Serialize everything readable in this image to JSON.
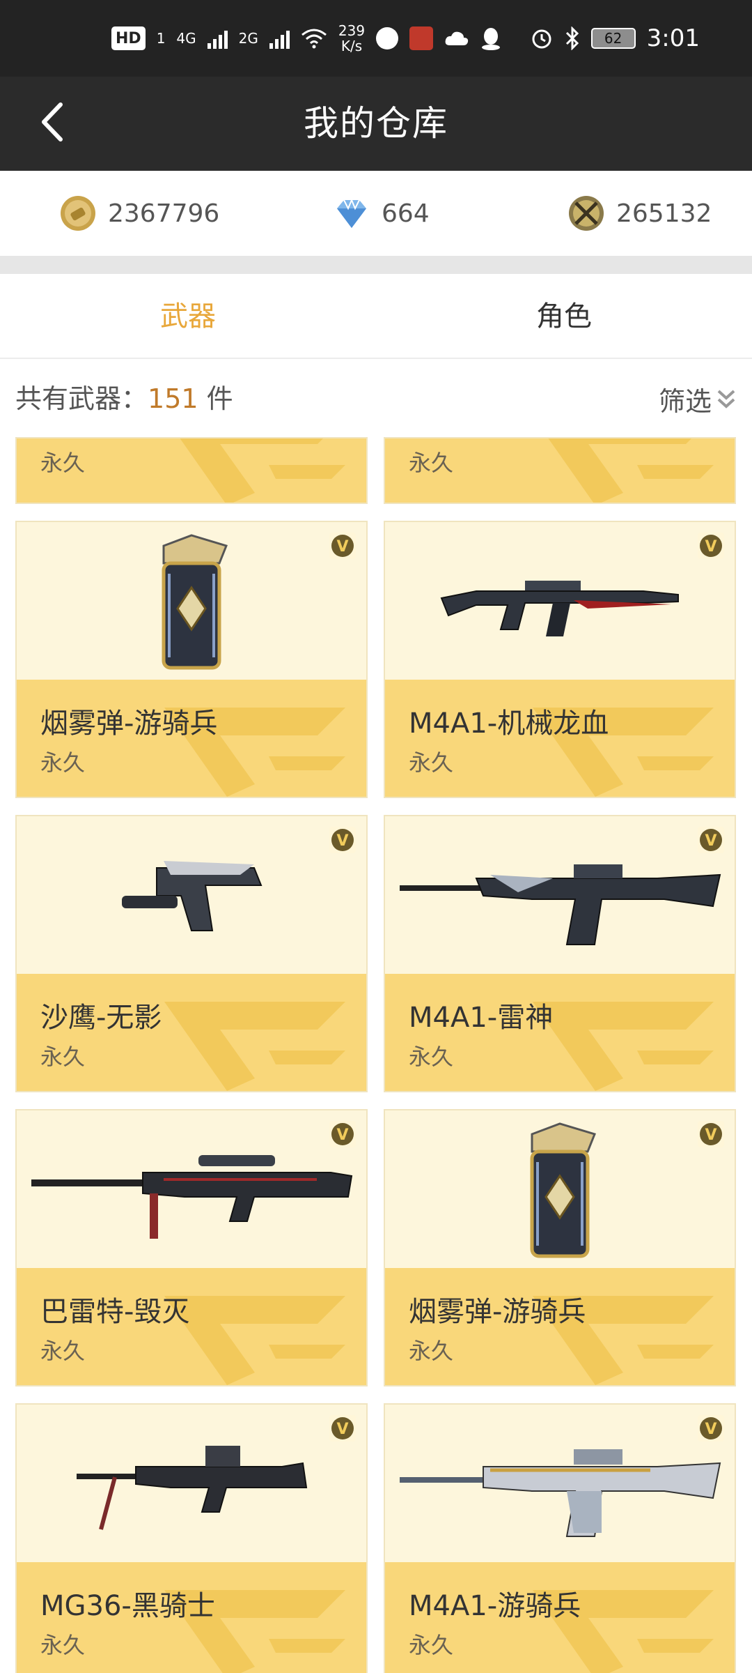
{
  "status_bar": {
    "hd_label": "HD",
    "sim1": "1",
    "net1": "4G",
    "net2": "2G",
    "speed_value": "239",
    "speed_unit": "K/s",
    "battery": "62",
    "time": "3:01"
  },
  "header": {
    "title": "我的仓库"
  },
  "currency": {
    "gold": "2367796",
    "diamond": "664",
    "medal": "265132"
  },
  "tabs": [
    {
      "label": "武器",
      "active": true
    },
    {
      "label": "角色",
      "active": false
    }
  ],
  "summary": {
    "prefix": "共有武器：",
    "count": "151",
    "suffix": "件",
    "filter_label": "筛选"
  },
  "partial_row": [
    {
      "duration": "永久"
    },
    {
      "duration": "永久"
    }
  ],
  "items": [
    {
      "name": "烟雾弹-游骑兵",
      "duration": "永久",
      "kind": "grenade"
    },
    {
      "name": "M4A1-机械龙血",
      "duration": "永久",
      "kind": "rifle"
    },
    {
      "name": "沙鹰-无影",
      "duration": "永久",
      "kind": "pistol"
    },
    {
      "name": "M4A1-雷神",
      "duration": "永久",
      "kind": "rifle"
    },
    {
      "name": "巴雷特-毁灭",
      "duration": "永久",
      "kind": "sniper"
    },
    {
      "name": "烟雾弹-游骑兵",
      "duration": "永久",
      "kind": "grenade"
    },
    {
      "name": "MG36-黑骑士",
      "duration": "永久",
      "kind": "mg"
    },
    {
      "name": "M4A1-游骑兵",
      "duration": "永久",
      "kind": "rifle"
    }
  ],
  "colors": {
    "accent": "#e8a73a",
    "card_bottom": "#f9d77a",
    "card_top": "#fdf6dc",
    "header_bg": "#2b2b2b"
  }
}
